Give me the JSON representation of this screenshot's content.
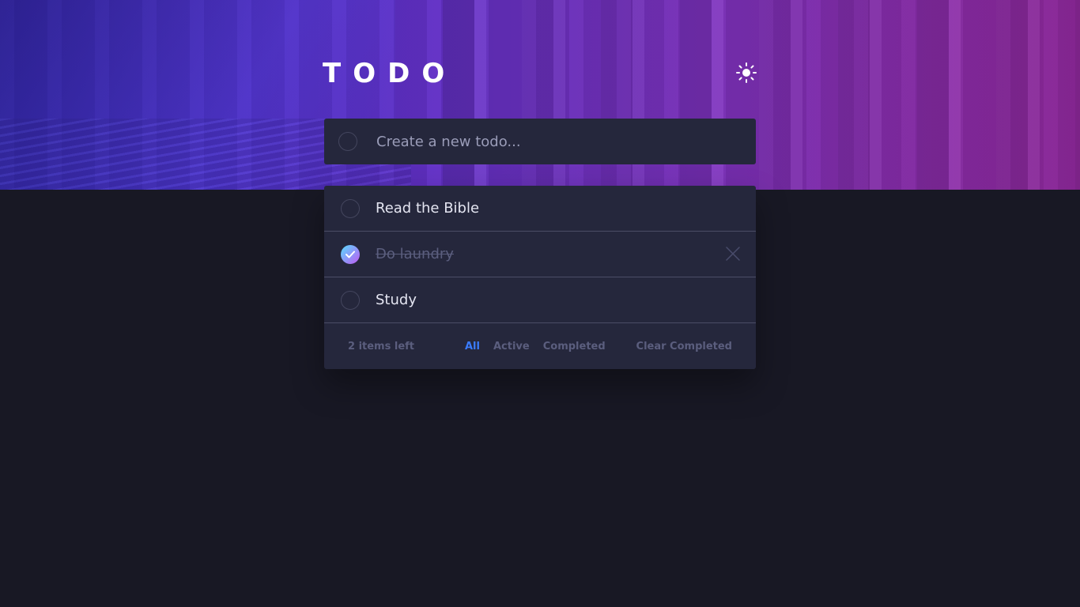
{
  "header": {
    "title": "TODO",
    "theme_icon": "sun-icon"
  },
  "new_todo": {
    "placeholder": "Create a new todo..."
  },
  "todos": [
    {
      "label": "Read the Bible",
      "completed": false
    },
    {
      "label": "Do laundry",
      "completed": true
    },
    {
      "label": "Study",
      "completed": false
    }
  ],
  "footer": {
    "items_left": "2 items left",
    "filters": {
      "all": "All",
      "active": "Active",
      "completed": "Completed"
    },
    "selected_filter": "All",
    "clear_label": "Clear Completed"
  },
  "colors": {
    "background": "#181824",
    "card": "#25273c",
    "accent": "#3a7bfd",
    "check_gradient_start": "#57ddff",
    "check_gradient_end": "#c058f3"
  }
}
